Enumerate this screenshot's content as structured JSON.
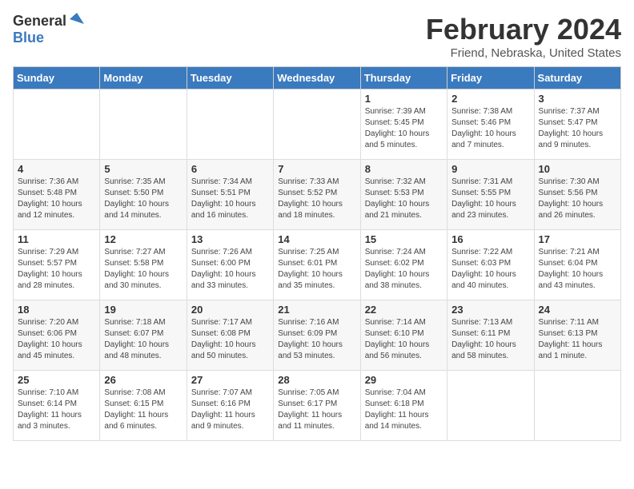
{
  "header": {
    "logo_general": "General",
    "logo_blue": "Blue",
    "month": "February 2024",
    "location": "Friend, Nebraska, United States"
  },
  "weekdays": [
    "Sunday",
    "Monday",
    "Tuesday",
    "Wednesday",
    "Thursday",
    "Friday",
    "Saturday"
  ],
  "weeks": [
    [
      {
        "day": "",
        "info": ""
      },
      {
        "day": "",
        "info": ""
      },
      {
        "day": "",
        "info": ""
      },
      {
        "day": "",
        "info": ""
      },
      {
        "day": "1",
        "info": "Sunrise: 7:39 AM\nSunset: 5:45 PM\nDaylight: 10 hours\nand 5 minutes."
      },
      {
        "day": "2",
        "info": "Sunrise: 7:38 AM\nSunset: 5:46 PM\nDaylight: 10 hours\nand 7 minutes."
      },
      {
        "day": "3",
        "info": "Sunrise: 7:37 AM\nSunset: 5:47 PM\nDaylight: 10 hours\nand 9 minutes."
      }
    ],
    [
      {
        "day": "4",
        "info": "Sunrise: 7:36 AM\nSunset: 5:48 PM\nDaylight: 10 hours\nand 12 minutes."
      },
      {
        "day": "5",
        "info": "Sunrise: 7:35 AM\nSunset: 5:50 PM\nDaylight: 10 hours\nand 14 minutes."
      },
      {
        "day": "6",
        "info": "Sunrise: 7:34 AM\nSunset: 5:51 PM\nDaylight: 10 hours\nand 16 minutes."
      },
      {
        "day": "7",
        "info": "Sunrise: 7:33 AM\nSunset: 5:52 PM\nDaylight: 10 hours\nand 18 minutes."
      },
      {
        "day": "8",
        "info": "Sunrise: 7:32 AM\nSunset: 5:53 PM\nDaylight: 10 hours\nand 21 minutes."
      },
      {
        "day": "9",
        "info": "Sunrise: 7:31 AM\nSunset: 5:55 PM\nDaylight: 10 hours\nand 23 minutes."
      },
      {
        "day": "10",
        "info": "Sunrise: 7:30 AM\nSunset: 5:56 PM\nDaylight: 10 hours\nand 26 minutes."
      }
    ],
    [
      {
        "day": "11",
        "info": "Sunrise: 7:29 AM\nSunset: 5:57 PM\nDaylight: 10 hours\nand 28 minutes."
      },
      {
        "day": "12",
        "info": "Sunrise: 7:27 AM\nSunset: 5:58 PM\nDaylight: 10 hours\nand 30 minutes."
      },
      {
        "day": "13",
        "info": "Sunrise: 7:26 AM\nSunset: 6:00 PM\nDaylight: 10 hours\nand 33 minutes."
      },
      {
        "day": "14",
        "info": "Sunrise: 7:25 AM\nSunset: 6:01 PM\nDaylight: 10 hours\nand 35 minutes."
      },
      {
        "day": "15",
        "info": "Sunrise: 7:24 AM\nSunset: 6:02 PM\nDaylight: 10 hours\nand 38 minutes."
      },
      {
        "day": "16",
        "info": "Sunrise: 7:22 AM\nSunset: 6:03 PM\nDaylight: 10 hours\nand 40 minutes."
      },
      {
        "day": "17",
        "info": "Sunrise: 7:21 AM\nSunset: 6:04 PM\nDaylight: 10 hours\nand 43 minutes."
      }
    ],
    [
      {
        "day": "18",
        "info": "Sunrise: 7:20 AM\nSunset: 6:06 PM\nDaylight: 10 hours\nand 45 minutes."
      },
      {
        "day": "19",
        "info": "Sunrise: 7:18 AM\nSunset: 6:07 PM\nDaylight: 10 hours\nand 48 minutes."
      },
      {
        "day": "20",
        "info": "Sunrise: 7:17 AM\nSunset: 6:08 PM\nDaylight: 10 hours\nand 50 minutes."
      },
      {
        "day": "21",
        "info": "Sunrise: 7:16 AM\nSunset: 6:09 PM\nDaylight: 10 hours\nand 53 minutes."
      },
      {
        "day": "22",
        "info": "Sunrise: 7:14 AM\nSunset: 6:10 PM\nDaylight: 10 hours\nand 56 minutes."
      },
      {
        "day": "23",
        "info": "Sunrise: 7:13 AM\nSunset: 6:11 PM\nDaylight: 10 hours\nand 58 minutes."
      },
      {
        "day": "24",
        "info": "Sunrise: 7:11 AM\nSunset: 6:13 PM\nDaylight: 11 hours\nand 1 minute."
      }
    ],
    [
      {
        "day": "25",
        "info": "Sunrise: 7:10 AM\nSunset: 6:14 PM\nDaylight: 11 hours\nand 3 minutes."
      },
      {
        "day": "26",
        "info": "Sunrise: 7:08 AM\nSunset: 6:15 PM\nDaylight: 11 hours\nand 6 minutes."
      },
      {
        "day": "27",
        "info": "Sunrise: 7:07 AM\nSunset: 6:16 PM\nDaylight: 11 hours\nand 9 minutes."
      },
      {
        "day": "28",
        "info": "Sunrise: 7:05 AM\nSunset: 6:17 PM\nDaylight: 11 hours\nand 11 minutes."
      },
      {
        "day": "29",
        "info": "Sunrise: 7:04 AM\nSunset: 6:18 PM\nDaylight: 11 hours\nand 14 minutes."
      },
      {
        "day": "",
        "info": ""
      },
      {
        "day": "",
        "info": ""
      }
    ]
  ]
}
